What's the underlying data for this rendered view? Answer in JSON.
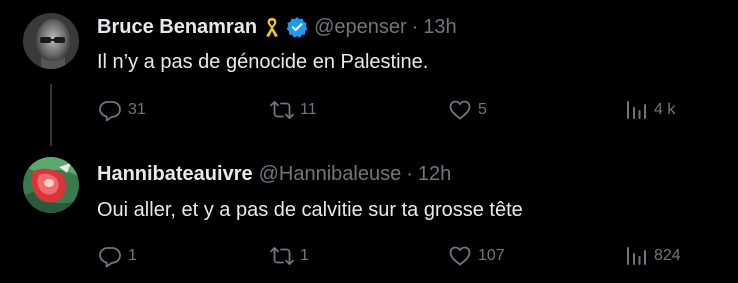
{
  "colors": {
    "background": "#000000",
    "text": "#e7e9ea",
    "muted": "#71767b",
    "verified": "#1d9bf0",
    "ribbon": "#f5c518"
  },
  "tweets": [
    {
      "display_name": "Bruce Benamran",
      "handle": "@epenser",
      "separator": "·",
      "time": "13h",
      "text": "Il n’y a pas de génocide en Palestine.",
      "badges": [
        "yellow-ribbon-icon",
        "verified-badge-icon"
      ],
      "actions": {
        "replies": "31",
        "reposts": "11",
        "likes": "5",
        "views": "4 k"
      }
    },
    {
      "display_name": "Hannibateauivre",
      "handle": "@Hannibaleuse",
      "separator": "·",
      "time": "12h",
      "text": "Oui aller, et y a pas de calvitie sur ta grosse tête",
      "badges": [],
      "actions": {
        "replies": "1",
        "reposts": "1",
        "likes": "107",
        "views": "824"
      }
    }
  ]
}
